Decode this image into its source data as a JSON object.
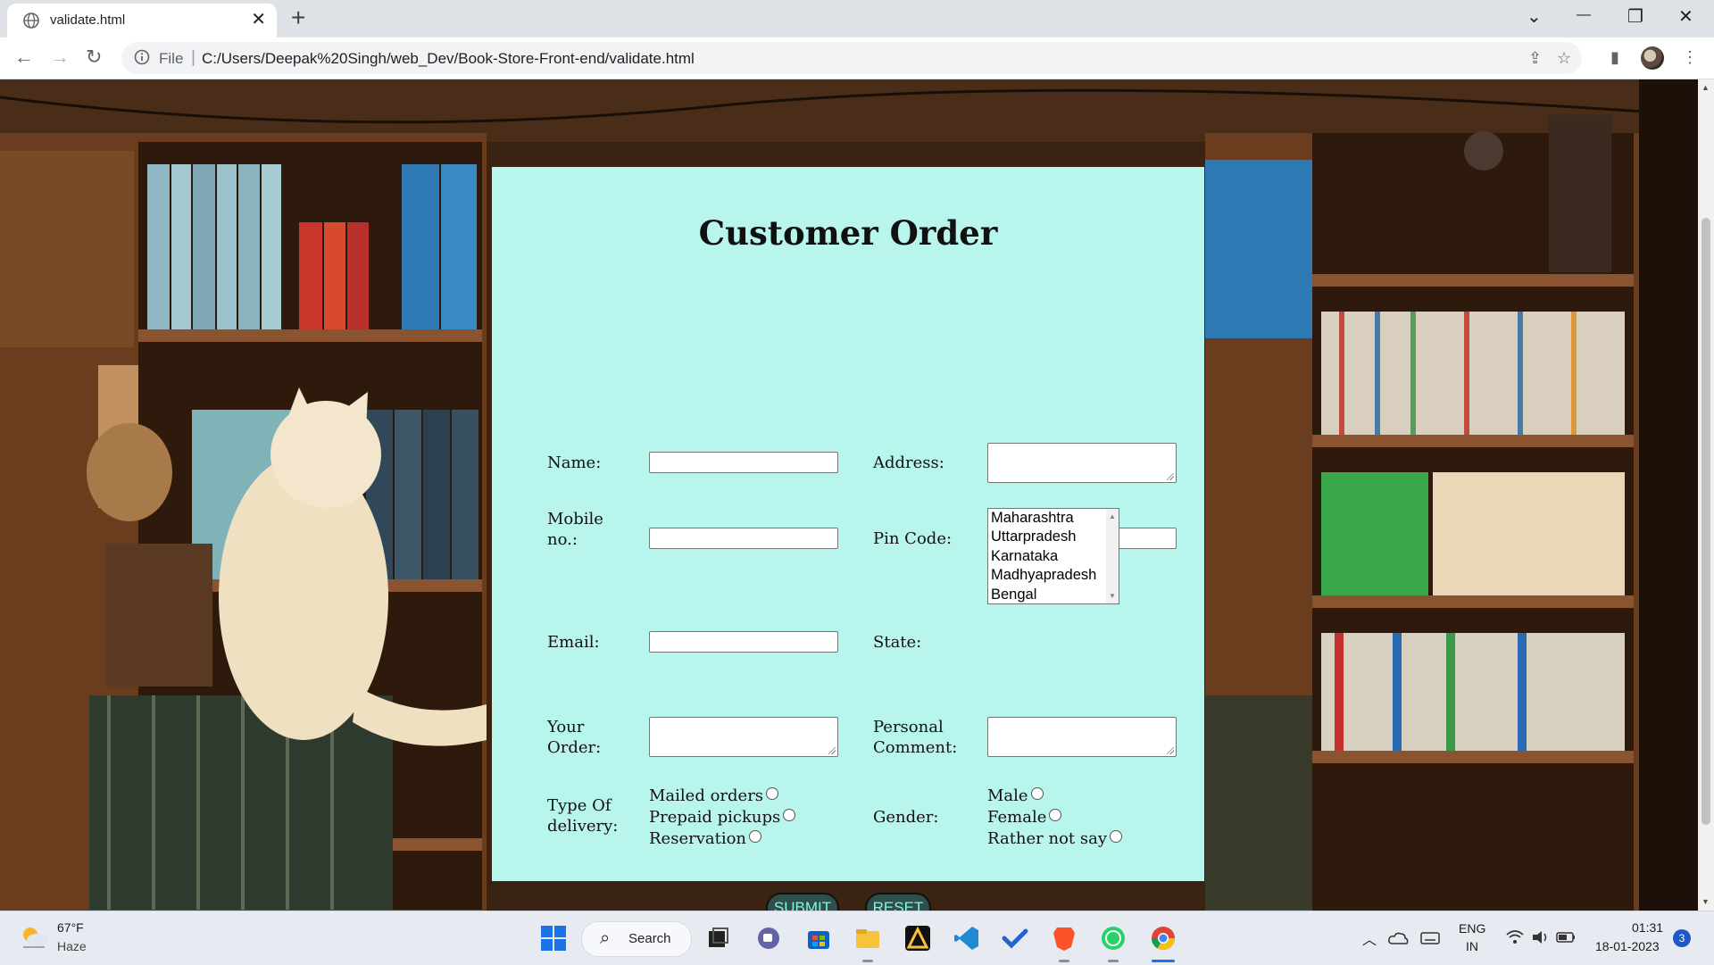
{
  "browser": {
    "tab_title": "validate.html",
    "tab_close": "✕",
    "new_tab": "+",
    "url_scheme": "File",
    "url": "C:/Users/Deepak%20Singh/web_Dev/Book-Store-Front-end/validate.html",
    "window_controls": {
      "dropdown": "⌄",
      "minimize": "—",
      "maximize": "❐",
      "close": "✕"
    },
    "nav": {
      "back": "←",
      "forward": "→",
      "reload": "↻"
    }
  },
  "form": {
    "title": "Customer Order",
    "labels": {
      "name": "Name:",
      "address": "Address:",
      "mobile_line1": "Mobile",
      "mobile_line2": "no.:",
      "pincode": "Pin Code:",
      "email": "Email:",
      "state": "State:",
      "order_line1": "Your",
      "order_line2": "Order:",
      "comment_line1": "Personal",
      "comment_line2": "Comment:",
      "delivery_line1": "Type Of",
      "delivery_line2": "delivery:",
      "gender": "Gender:"
    },
    "fields": {
      "name": "",
      "address": "",
      "mobile": "",
      "pincode": "",
      "email": "",
      "order": "",
      "comment": ""
    },
    "state_options": [
      "Maharashtra",
      "Uttarpradesh",
      "Karnataka",
      "Madhyapradesh",
      "Bengal"
    ],
    "delivery_options": [
      "Mailed orders",
      "Prepaid pickups",
      "Reservation"
    ],
    "gender_options": [
      "Male",
      "Female",
      "Rather not say"
    ],
    "submit_label": "SUBMIT",
    "reset_label": "RESET",
    "colors": {
      "card": "#b8f5ec",
      "button": "#2e4f4a",
      "button_text": "#7ff5ea"
    }
  },
  "taskbar": {
    "weather_temp": "67°F",
    "weather_cond": "Haze",
    "search_label": "Search",
    "lang_line1": "ENG",
    "lang_line2": "IN",
    "time": "01:31",
    "date": "18-01-2023",
    "notification_count": "3"
  }
}
